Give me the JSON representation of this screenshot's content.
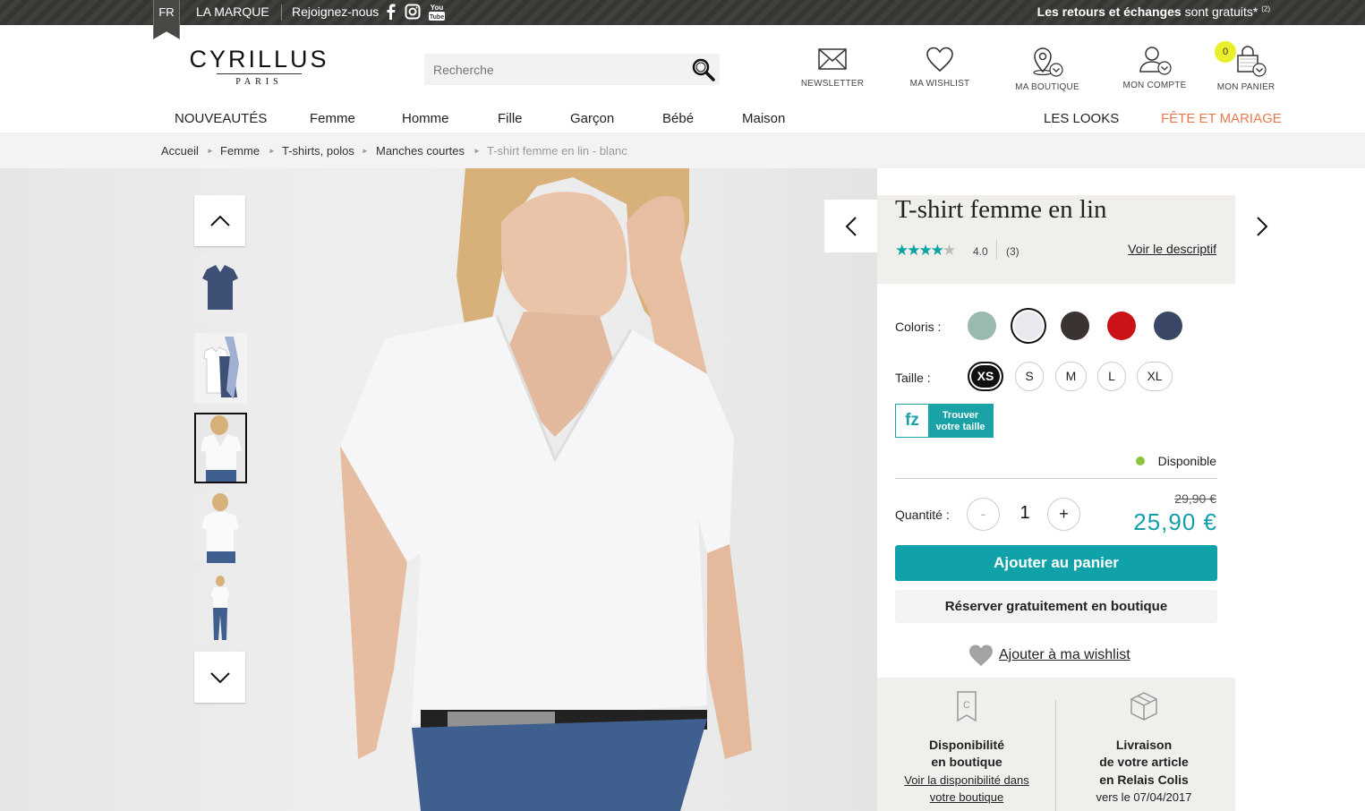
{
  "topbar": {
    "lang": "FR",
    "la_marque": "LA MARQUE",
    "join": "Rejoignez-nous",
    "social": [
      "f",
      "ig",
      "You Tube"
    ],
    "promo_bold": "Les retours et échanges",
    "promo_rest": " sont gratuits*",
    "promo_sup": "(2)"
  },
  "header": {
    "logo_main": "CYRILLUS",
    "logo_sub": "PARIS",
    "search_placeholder": "Recherche",
    "icons": {
      "newsletter": "NEWSLETTER",
      "wishlist": "MA WISHLIST",
      "boutique": "MA BOUTIQUE",
      "compte": "MON COMPTE",
      "panier": "MON PANIER"
    },
    "cart_count": "0"
  },
  "nav": {
    "items": [
      "NOUVEAUTÉS",
      "Femme",
      "Homme",
      "Fille",
      "Garçon",
      "Bébé",
      "Maison"
    ],
    "looks": "LES LOOKS",
    "fete": "FÊTE ET MARIAGE",
    "fete_color": "#e57a50"
  },
  "breadcrumb": [
    "Accueil",
    "Femme",
    "T-shirts, polos",
    "Manches courtes",
    "T-shirt femme en lin - blanc"
  ],
  "product": {
    "title": "T-shirt femme en lin",
    "rating": "4.0",
    "rating_value": 4,
    "review_count": "(3)",
    "voir_descriptif": "Voir le descriptif",
    "colors_label": "Coloris :",
    "colors": [
      "#9cb9ae",
      "#e9eaef",
      "#3b3331",
      "#cc1219",
      "#3a4766"
    ],
    "size_label": "Taille :",
    "sizes": [
      "XS",
      "S",
      "M",
      "L",
      "XL"
    ],
    "fit_logo": "fz",
    "fit_label_1": "Trouver",
    "fit_label_2": "votre taille",
    "availability": "Disponible",
    "qty_label": "Quantité :",
    "qty_minus": "-",
    "qty_value": "1",
    "qty_plus": "+",
    "old_price": "29,90 €",
    "price": "25,90 €",
    "add_to_cart": "Ajouter au panier",
    "reserve": "Réserver gratuitement en boutique",
    "wishlist": "Ajouter à ma wishlist",
    "accent_color": "#11a1a8"
  },
  "footer_info": {
    "store_l1": "Disponibilité",
    "store_l2": "en boutique",
    "store_link_1": "Voir la disponibilité dans",
    "store_link_2": "votre boutique",
    "delivery_l1": "Livraison",
    "delivery_l2": "de votre article",
    "delivery_l3": "en Relais Colis",
    "delivery_date": "vers le 07/04/2017"
  }
}
